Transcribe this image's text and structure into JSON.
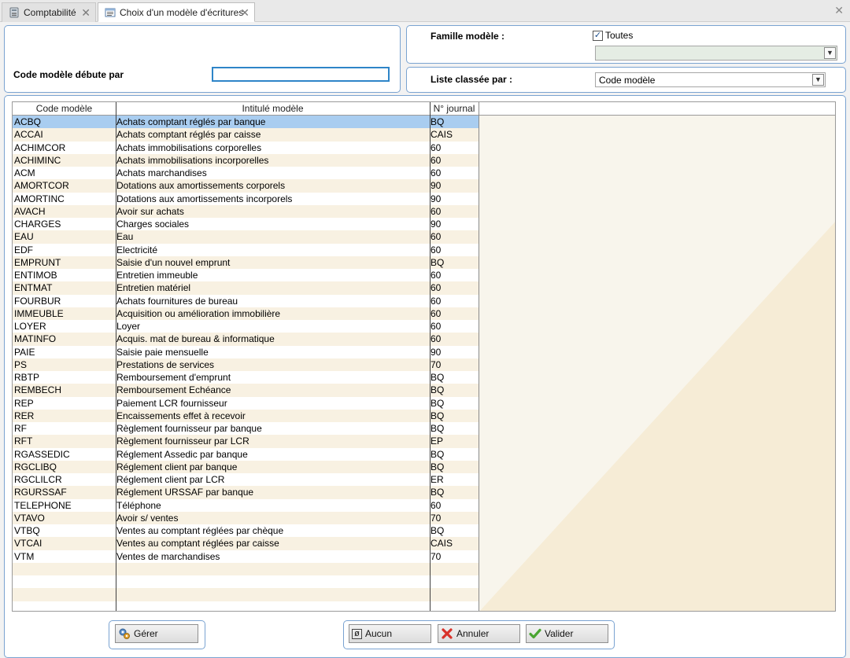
{
  "tabs": [
    {
      "label": "Comptabilité"
    },
    {
      "label": "Choix d'un modèle d'écritures"
    }
  ],
  "filters": {
    "code_label": "Code modèle débute par",
    "code_value": "",
    "famille_label": "Famille modèle :",
    "toutes_label": "Toutes",
    "toutes_checked": true,
    "famille_value": "",
    "liste_label": "Liste classée par :",
    "liste_value": "Code modèle"
  },
  "table": {
    "headers": [
      "Code modèle",
      "Intitulé modèle",
      "N° journal"
    ],
    "rows": [
      [
        "ACBQ",
        "Achats comptant réglés par banque",
        "BQ"
      ],
      [
        "ACCAI",
        "Achats comptant réglés par caisse",
        "CAIS"
      ],
      [
        "ACHIMCOR",
        "Achats immobilisations corporelles",
        "60"
      ],
      [
        "ACHIMINC",
        "Achats immobilisations incorporelles",
        "60"
      ],
      [
        "ACM",
        "Achats marchandises",
        "60"
      ],
      [
        "AMORTCOR",
        "Dotations aux amortissements corporels",
        "90"
      ],
      [
        "AMORTINC",
        "Dotations aux amortissements incorporels",
        "90"
      ],
      [
        "AVACH",
        "Avoir sur achats",
        "60"
      ],
      [
        "CHARGES",
        "Charges sociales",
        "90"
      ],
      [
        "EAU",
        "Eau",
        "60"
      ],
      [
        "EDF",
        "Electricité",
        "60"
      ],
      [
        "EMPRUNT",
        "Saisie d'un nouvel emprunt",
        "BQ"
      ],
      [
        "ENTIMOB",
        "Entretien immeuble",
        "60"
      ],
      [
        "ENTMAT",
        "Entretien matériel",
        "60"
      ],
      [
        "FOURBUR",
        "Achats fournitures de bureau",
        "60"
      ],
      [
        "IMMEUBLE",
        "Acquisition ou amélioration immobilière",
        "60"
      ],
      [
        "LOYER",
        "Loyer",
        "60"
      ],
      [
        "MATINFO",
        "Acquis. mat de bureau & informatique",
        "60"
      ],
      [
        "PAIE",
        "Saisie paie mensuelle",
        "90"
      ],
      [
        "PS",
        "Prestations de services",
        "70"
      ],
      [
        "RBTP",
        "Remboursement d'emprunt",
        "BQ"
      ],
      [
        "REMBECH",
        "Remboursement Echéance",
        "BQ"
      ],
      [
        "REP",
        "Paiement LCR fournisseur",
        "BQ"
      ],
      [
        "RER",
        "Encaissements effet à recevoir",
        "BQ"
      ],
      [
        "RF",
        "Règlement fournisseur par banque",
        "BQ"
      ],
      [
        "RFT",
        "Règlement fournisseur par LCR",
        "EP"
      ],
      [
        "RGASSEDIC",
        "Réglement Assedic par banque",
        "BQ"
      ],
      [
        "RGCLIBQ",
        "Réglement client par banque",
        "BQ"
      ],
      [
        "RGCLILCR",
        "Réglement client par LCR",
        "ER"
      ],
      [
        "RGURSSAF",
        "Réglement URSSAF par banque",
        "BQ"
      ],
      [
        "TELEPHONE",
        "Téléphone",
        "60"
      ],
      [
        "VTAVO",
        "Avoir s/ ventes",
        "70"
      ],
      [
        "VTBQ",
        "Ventes au comptant réglées par chèque",
        "BQ"
      ],
      [
        "VTCAI",
        "Ventes au comptant réglées par caisse",
        "CAIS"
      ],
      [
        "VTM",
        "Ventes de marchandises",
        "70"
      ]
    ],
    "selected_index": 0
  },
  "buttons": {
    "gerer": "Gérer",
    "aucun": "Aucun",
    "annuler": "Annuler",
    "valider": "Valider"
  },
  "colors": {
    "accent_border": "#7aa3d1",
    "selected_row": "#a9cdf0",
    "alt_row": "#f8f1e2"
  }
}
